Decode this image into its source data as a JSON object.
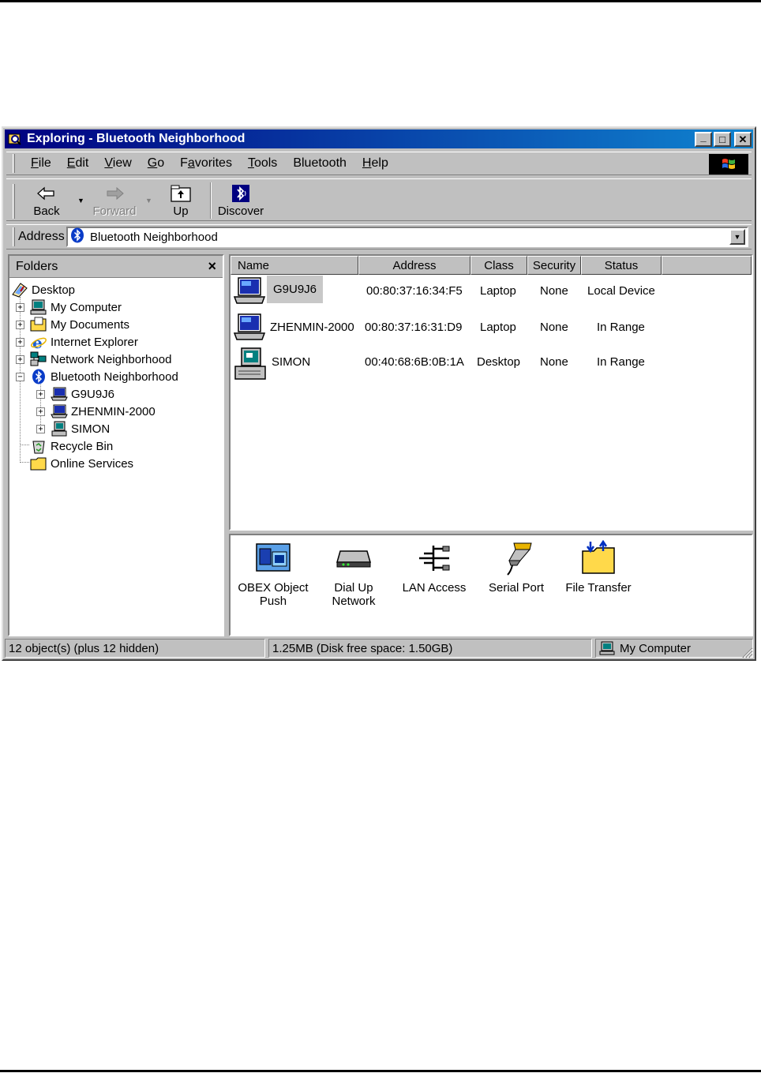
{
  "window": {
    "title": "Exploring - Bluetooth Neighborhood",
    "buttons": {
      "minimize": "_",
      "maximize": "□",
      "close": "✕"
    }
  },
  "menu": {
    "items": [
      {
        "label": "File",
        "accel": "F",
        "rest": "ile"
      },
      {
        "label": "Edit",
        "accel": "E",
        "rest": "dit"
      },
      {
        "label": "View",
        "accel": "V",
        "rest": "iew"
      },
      {
        "label": "Go",
        "accel": "G",
        "rest": "o"
      },
      {
        "label": "Favorites",
        "accel": "a",
        "pre": "F",
        "rest": "vorites"
      },
      {
        "label": "Tools",
        "accel": "T",
        "rest": "ools"
      },
      {
        "label": "Bluetooth",
        "accel": "",
        "rest": "Bluetooth"
      },
      {
        "label": "Help",
        "accel": "H",
        "rest": "elp"
      }
    ]
  },
  "toolbar": {
    "back": "Back",
    "forward": "Forward",
    "up": "Up",
    "discover": "Discover"
  },
  "address": {
    "label": "Address",
    "value": "Bluetooth Neighborhood"
  },
  "folders": {
    "header": "Folders",
    "close": "×",
    "tree": [
      {
        "label": "Desktop",
        "icon": "desktop-icon"
      },
      {
        "label": "My Computer",
        "icon": "computer-icon",
        "expander": "+"
      },
      {
        "label": "My Documents",
        "icon": "folder-icon",
        "expander": "+"
      },
      {
        "label": "Internet Explorer",
        "icon": "internet-explorer-icon",
        "expander": "+"
      },
      {
        "label": "Network Neighborhood",
        "icon": "network-icon",
        "expander": "+"
      },
      {
        "label": "Bluetooth Neighborhood",
        "icon": "bluetooth-icon",
        "expander": "−"
      },
      {
        "label": "G9U9J6",
        "icon": "laptop-icon",
        "expander": "+"
      },
      {
        "label": "ZHENMIN-2000",
        "icon": "laptop-icon",
        "expander": "+"
      },
      {
        "label": "SIMON",
        "icon": "desktop-pc-icon",
        "expander": "+"
      },
      {
        "label": "Recycle Bin",
        "icon": "recycle-bin-icon"
      },
      {
        "label": "Online Services",
        "icon": "folder-icon"
      }
    ]
  },
  "devices": {
    "columns": [
      "Name",
      "Address",
      "Class",
      "Security",
      "Status"
    ],
    "rows": [
      {
        "name": "G9U9J6",
        "address": "00:80:37:16:34:F5",
        "class": "Laptop",
        "security": "None",
        "status": "Local Device",
        "icon": "laptop-icon"
      },
      {
        "name": "ZHENMIN-2000",
        "address": "00:80:37:16:31:D9",
        "class": "Laptop",
        "security": "None",
        "status": "In Range",
        "icon": "laptop-icon"
      },
      {
        "name": "SIMON",
        "address": "00:40:68:6B:0B:1A",
        "class": "Desktop",
        "security": "None",
        "status": "In Range",
        "icon": "desktop-pc-icon"
      }
    ]
  },
  "services": [
    {
      "line1": "OBEX Object",
      "line2": "Push",
      "icon": "obex-icon"
    },
    {
      "line1": "Dial Up",
      "line2": "Network",
      "icon": "modem-icon"
    },
    {
      "line1": "LAN Access",
      "line2": "",
      "icon": "lan-icon"
    },
    {
      "line1": "Serial Port",
      "line2": "",
      "icon": "serial-port-icon"
    },
    {
      "line1": "File Transfer",
      "line2": "",
      "icon": "file-transfer-icon"
    }
  ],
  "status": {
    "objects": "12 object(s) (plus 12 hidden)",
    "disk": "1.25MB (Disk free space: 1.50GB)",
    "location": "My Computer"
  },
  "colors": {
    "title_start": "#000080",
    "title_end": "#1084d0",
    "face": "#c0c0c0"
  }
}
